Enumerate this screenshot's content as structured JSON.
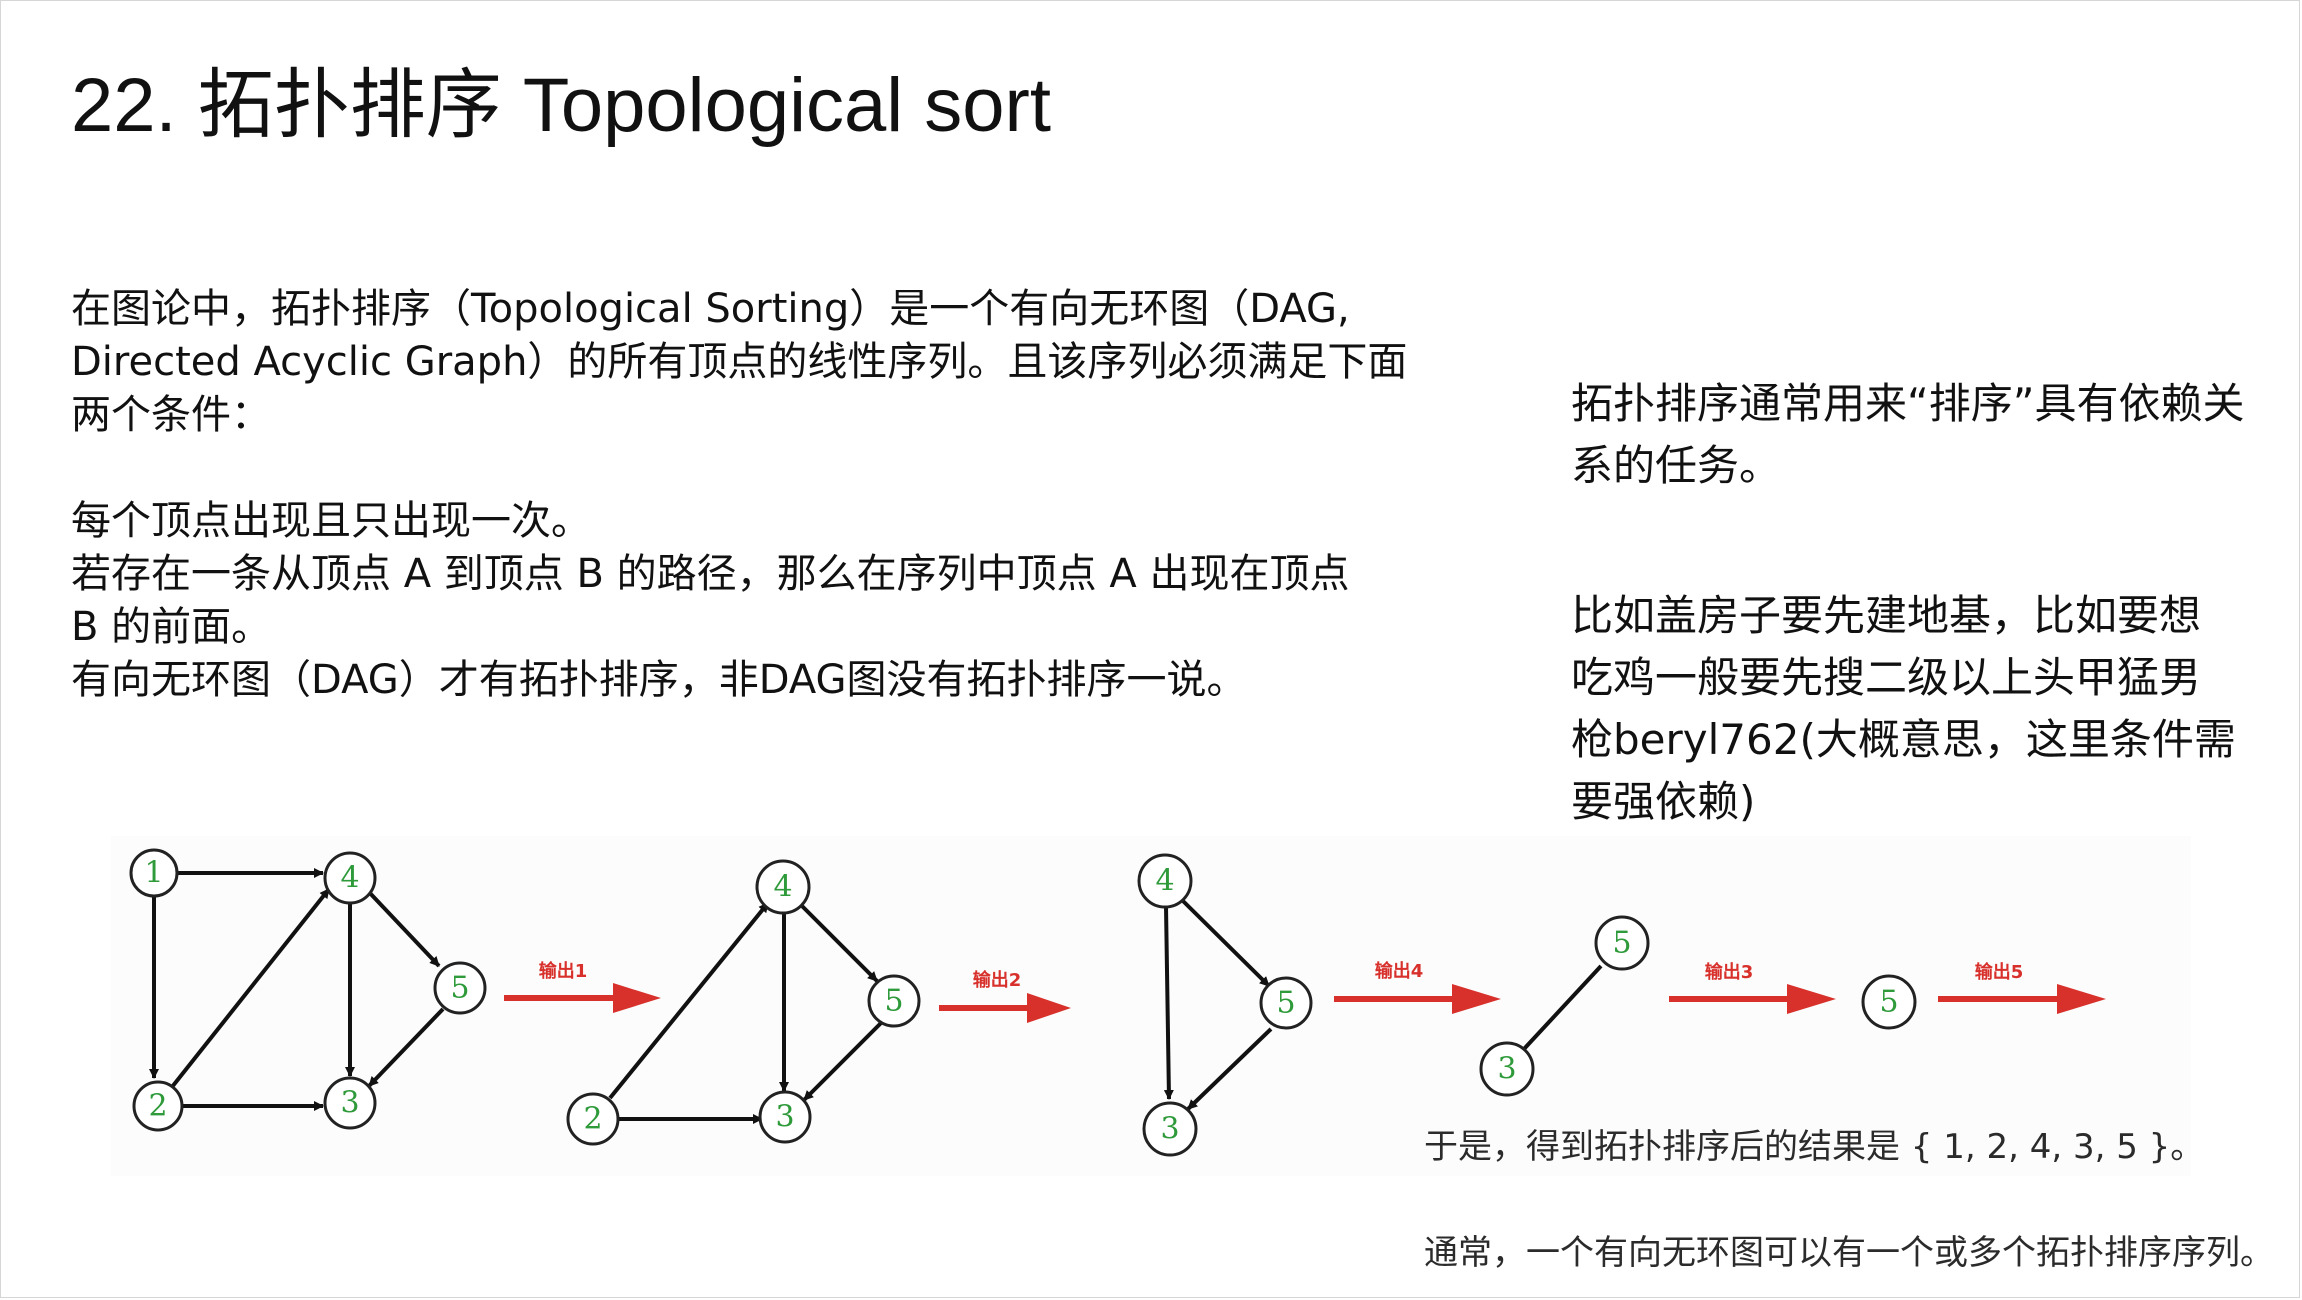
{
  "title": "22. 拓扑排序 Topological sort",
  "left_text": {
    "line1": "在图论中，拓扑排序（Topological Sorting）是一个有向无环图（DAG,",
    "line2": "Directed Acyclic Graph）的所有顶点的线性序列。且该序列必须满足下面",
    "line3": "两个条件：",
    "line4": "每个顶点出现且只出现一次。",
    "line5": "若存在一条从顶点 A 到顶点 B 的路径，那么在序列中顶点 A 出现在顶点",
    "line6": "B 的前面。",
    "line7": "有向无环图（DAG）才有拓扑排序，非DAG图没有拓扑排序一说。"
  },
  "right_text": {
    "line1": "拓扑排序通常用来“排序”具有依赖关",
    "line2": "系的任务。",
    "line3": "比如盖房子要先建地基，比如要想",
    "line4": "吃鸡一般要先搜二级以上头甲猛男",
    "line5": "枪beryl762(大概意思，这里条件需",
    "line6": "要强依赖)"
  },
  "diagram": {
    "step_labels": [
      "输出1",
      "输出2",
      "输出4",
      "输出3",
      "输出5"
    ],
    "node_labels": [
      "1",
      "2",
      "3",
      "4",
      "5"
    ],
    "colors": {
      "node_label": "#2e9a3a",
      "arrow": "#d8312c",
      "edge": "#111111"
    }
  },
  "bottom_notes": {
    "result": "于是，得到拓扑排序后的结果是 { 1, 2, 4, 3, 5 }。",
    "usually": "通常，一个有向无环图可以有一个或多个拓扑排序序列。"
  }
}
